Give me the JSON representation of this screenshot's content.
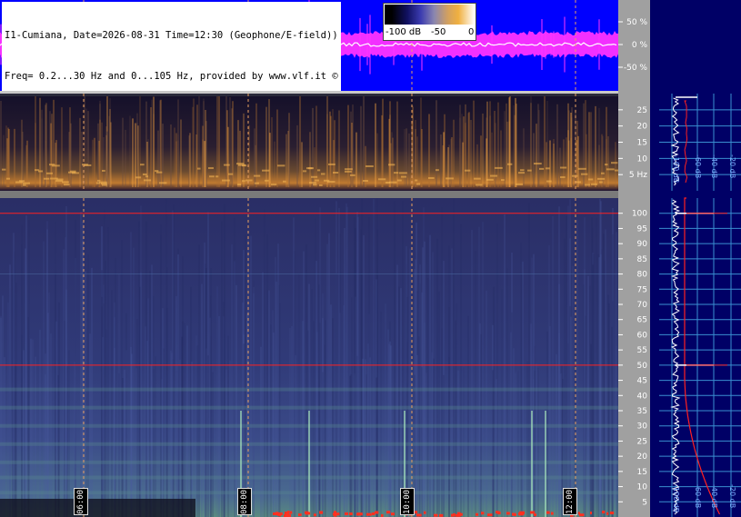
{
  "header": {
    "line1": "I1-Cumiana, Date=2026-08-31 Time=12:30 (Geophone/E-field))",
    "line2": "Freq= 0.2...30 Hz and 0...105 Hz, provided by www.vlf.it ©"
  },
  "colorbar": {
    "tick_labels": [
      "-100 dB",
      "-50",
      "0"
    ],
    "colors": [
      "#000000",
      "#101060",
      "#3b3bb0",
      "#8a86b0",
      "#d2a060",
      "#f0b040",
      "#ffffff"
    ]
  },
  "time_labels": [
    "06:00",
    "08:00",
    "10:00",
    "12:00"
  ],
  "colors": {
    "amplitude_bg": "#0000ff",
    "amplitude_trace": "#ff33ff",
    "axis_panel": "#a0a0a0",
    "right_panel": "#000066",
    "grid": "#3a8fd0",
    "marker_red": "#ff2020",
    "dashed_time": "#e8a060"
  },
  "chart_data": [
    {
      "type": "line",
      "panel": "amplitude",
      "ylabel_ticks": [
        "50 %",
        "0 %",
        "-50 %"
      ],
      "y_ticks": [
        50,
        0,
        -50
      ],
      "ylim": [
        -100,
        100
      ]
    },
    {
      "type": "heatmap",
      "panel": "spectrogram-low",
      "y_ticks": [
        25,
        20,
        15,
        10,
        5
      ],
      "y_tick_labels": [
        "25",
        "20",
        "15",
        "10",
        "5 Hz"
      ],
      "ylim": [
        0.2,
        30
      ]
    },
    {
      "type": "heatmap",
      "panel": "spectrogram-high",
      "y_ticks": [
        100,
        95,
        90,
        85,
        80,
        75,
        70,
        65,
        60,
        55,
        50,
        45,
        40,
        35,
        30,
        25,
        20,
        15,
        10,
        5
      ],
      "ylim": [
        0,
        105
      ],
      "marker_lines_hz": [
        100,
        50
      ]
    },
    {
      "type": "line",
      "panel": "spectrum-low",
      "x_tick_labels": [
        "-100 dB",
        "-60 dB",
        "-40 dB",
        "-20 dB"
      ],
      "ylim": [
        0.2,
        30
      ]
    },
    {
      "type": "line",
      "panel": "spectrum-high",
      "x_tick_labels": [
        "-100 dB",
        "-60 dB",
        "-40 dB",
        "-20 dB"
      ],
      "ylim": [
        0,
        105
      ]
    }
  ]
}
